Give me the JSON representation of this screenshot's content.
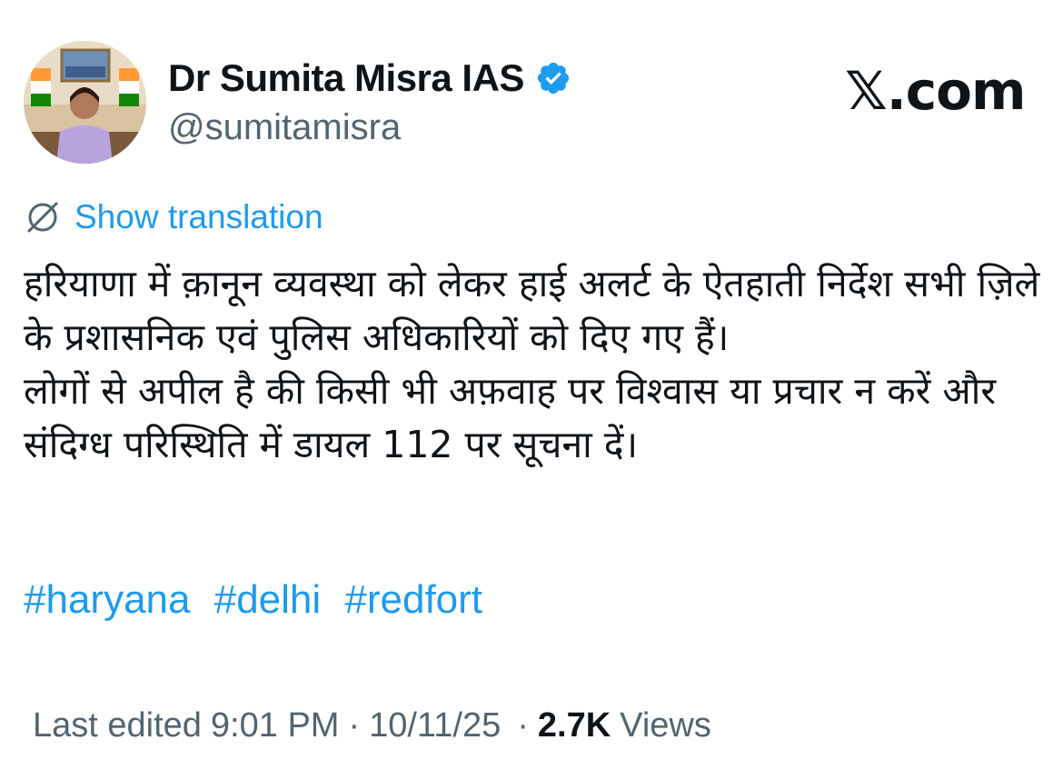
{
  "author": {
    "display_name": "Dr Sumita Misra IAS",
    "handle": "@sumitamisra",
    "verified": true,
    "verified_color": "#1d9bf0",
    "avatar_icon": "profile-photo"
  },
  "site_logo": "𝕏.com",
  "translate": {
    "icon": "globe-slash-icon",
    "label": "Show translation"
  },
  "tweet": {
    "paragraph_1": "हरियाणा में क़ानून व्यवस्था को लेकर हाई अलर्ट के ऐतहाती निर्देश सभी ज़िले के प्रशासनिक एवं पुलिस अधिकारियों को दिए गए हैं।",
    "paragraph_2": "लोगों से अपील है की किसी भी अफ़वाह पर विश्वास या प्रचार न करें और संदिग्ध परिस्थिति में डायल 112 पर सूचना दें।",
    "hashtags": [
      "#haryana",
      "#delhi",
      "#redfort"
    ]
  },
  "meta": {
    "prefix": "Last edited",
    "time": "9:01 PM",
    "separator": "·",
    "date": "10/11/25",
    "views_count": "2.7K",
    "views_label": "Views"
  },
  "colors": {
    "link": "#1d9bf0",
    "text": "#0f1419",
    "secondary": "#536471"
  }
}
